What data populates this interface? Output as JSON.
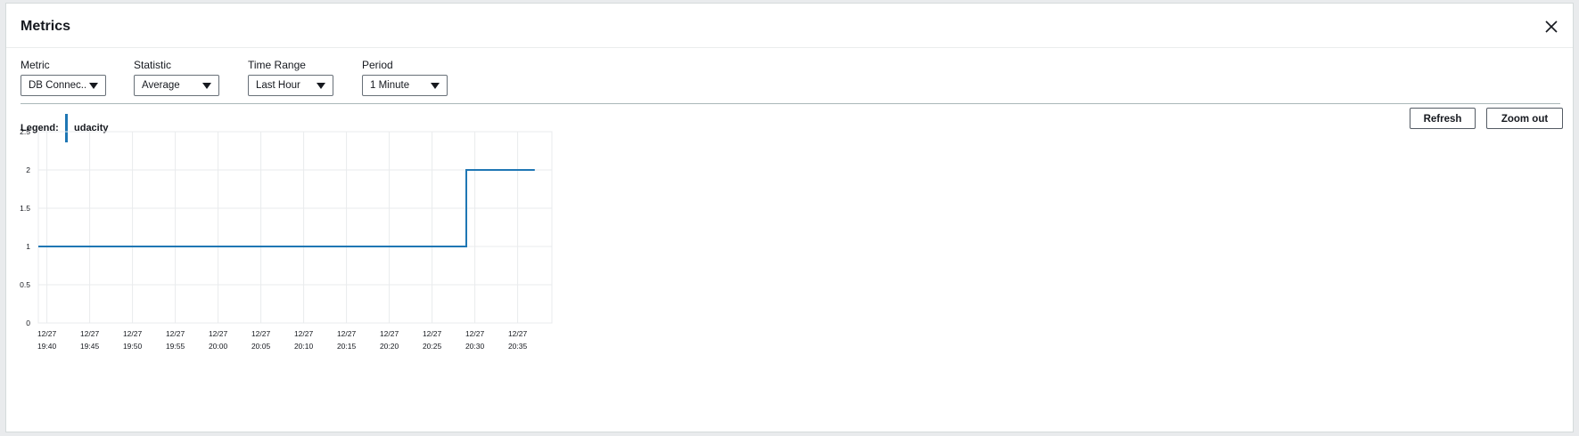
{
  "modal": {
    "title": "Metrics"
  },
  "controls": [
    {
      "label": "Metric",
      "value": "DB Connec..."
    },
    {
      "label": "Statistic",
      "value": "Average"
    },
    {
      "label": "Time Range",
      "value": "Last Hour"
    },
    {
      "label": "Period",
      "value": "1 Minute"
    }
  ],
  "legend": {
    "label": "Legend:",
    "entry": "udacity",
    "color": "#1f77b4"
  },
  "buttons": {
    "refresh": "Refresh",
    "zoom_out": "Zoom out"
  },
  "icons": {
    "close": "close-icon",
    "dropdown": "caret-down-icon"
  },
  "chart_data": {
    "type": "line",
    "series": [
      {
        "name": "udacity",
        "color": "#1f77b4",
        "step": true,
        "points": [
          {
            "x": "19:39",
            "y": 1
          },
          {
            "x": "20:29",
            "y": 1
          },
          {
            "x": "20:29",
            "y": 2
          },
          {
            "x": "20:37",
            "y": 2
          }
        ]
      }
    ],
    "x_ticks": [
      {
        "date": "12/27",
        "time": "19:40"
      },
      {
        "date": "12/27",
        "time": "19:45"
      },
      {
        "date": "12/27",
        "time": "19:50"
      },
      {
        "date": "12/27",
        "time": "19:55"
      },
      {
        "date": "12/27",
        "time": "20:00"
      },
      {
        "date": "12/27",
        "time": "20:05"
      },
      {
        "date": "12/27",
        "time": "20:10"
      },
      {
        "date": "12/27",
        "time": "20:15"
      },
      {
        "date": "12/27",
        "time": "20:20"
      },
      {
        "date": "12/27",
        "time": "20:25"
      },
      {
        "date": "12/27",
        "time": "20:30"
      },
      {
        "date": "12/27",
        "time": "20:35"
      }
    ],
    "y_ticks": [
      "2.5",
      "2",
      "1.5",
      "1",
      "0.5",
      "0"
    ],
    "ylim": [
      0,
      2.5
    ],
    "xlim": [
      "19:39",
      "20:39"
    ],
    "grid": true
  }
}
